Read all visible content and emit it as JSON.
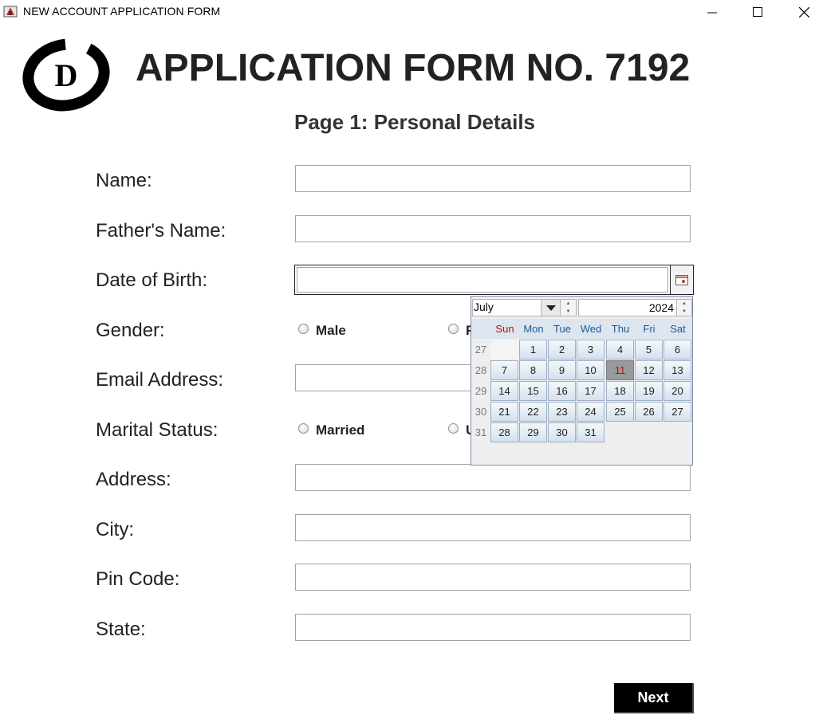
{
  "window": {
    "title": "NEW ACCOUNT APPLICATION FORM",
    "controls": [
      "minimize",
      "maximize",
      "close"
    ]
  },
  "logo": {
    "letter": "D"
  },
  "header": {
    "title": "APPLICATION FORM NO. 7192",
    "subtitle": "Page 1: Personal Details"
  },
  "form": {
    "name_label": "Name:",
    "name_value": "",
    "father_label": "Father's Name:",
    "father_value": "",
    "dob_label": "Date of Birth:",
    "dob_value": "",
    "gender_label": "Gender:",
    "gender_options": [
      "Male",
      "F"
    ],
    "email_label": "Email Address:",
    "email_value": "",
    "marital_label": "Marital Status:",
    "marital_options": [
      "Married",
      "U"
    ],
    "address_label": "Address:",
    "address_value": "",
    "city_label": "City:",
    "city_value": "",
    "pin_label": "Pin Code:",
    "pin_value": "",
    "state_label": "State:",
    "state_value": "",
    "next_label": "Next"
  },
  "calendar": {
    "month": "July",
    "year": "2024",
    "day_names": [
      "Sun",
      "Mon",
      "Tue",
      "Wed",
      "Thu",
      "Fri",
      "Sat"
    ],
    "weekend_color": "#b01010",
    "weekday_color": "#1a5a9c",
    "selected_day": "11",
    "weeks": [
      {
        "num": "27",
        "days": [
          "",
          "1",
          "2",
          "3",
          "4",
          "5",
          "6"
        ]
      },
      {
        "num": "28",
        "days": [
          "7",
          "8",
          "9",
          "10",
          "11",
          "12",
          "13"
        ]
      },
      {
        "num": "29",
        "days": [
          "14",
          "15",
          "16",
          "17",
          "18",
          "19",
          "20"
        ]
      },
      {
        "num": "30",
        "days": [
          "21",
          "22",
          "23",
          "24",
          "25",
          "26",
          "27"
        ]
      },
      {
        "num": "31",
        "days": [
          "28",
          "29",
          "30",
          "31",
          "",
          "",
          ""
        ]
      }
    ]
  }
}
